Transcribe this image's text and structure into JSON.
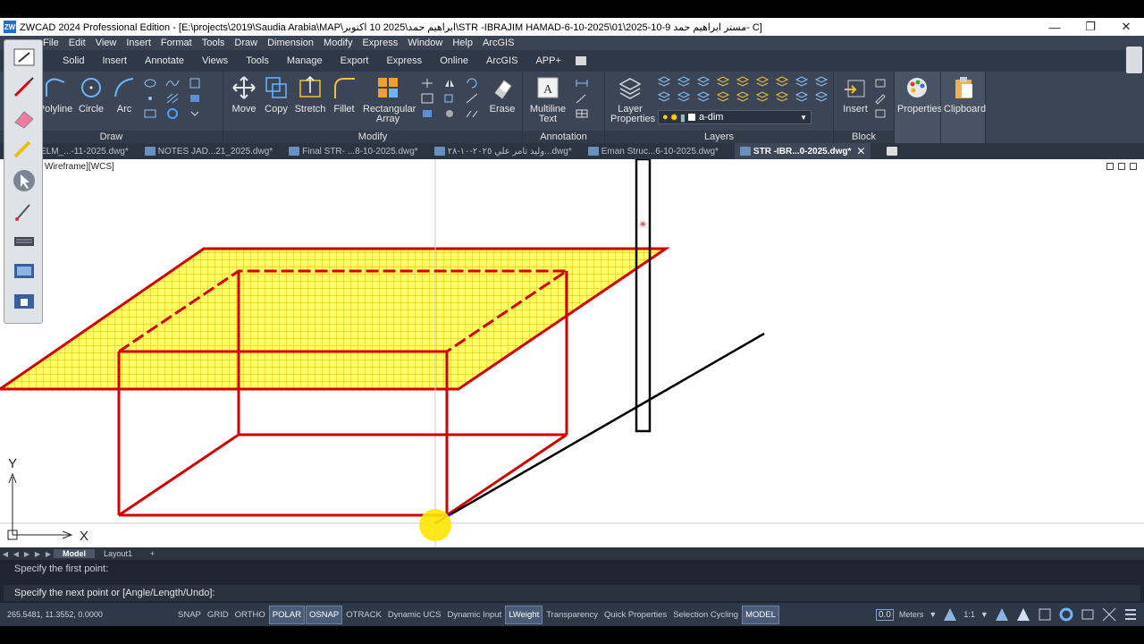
{
  "titlebar": {
    "app_icon_text": "ZW",
    "title": "ZWCAD 2024 Professional Edition - [E:\\projects\\2019\\Saudia Arabia\\MAP\\ابراهيم حمد\\2025 10 اكتوبر\\STR -IBRAJIM HAMAD-6-10-2025\\01\\2025-10-9 مستر ابراهيم حمد- C]",
    "minimize": "—",
    "restore": "❐",
    "close": "✕"
  },
  "menu": [
    "File",
    "Edit",
    "View",
    "Insert",
    "Format",
    "Tools",
    "Draw",
    "Dimension",
    "Modify",
    "Express",
    "Window",
    "Help",
    "ArcGIS"
  ],
  "ribbon_tabs": [
    "Solid",
    "Insert",
    "Annotate",
    "Views",
    "Tools",
    "Manage",
    "Export",
    "Express",
    "Online",
    "ArcGIS",
    "APP+"
  ],
  "ribbon": {
    "draw": {
      "label": "Draw",
      "polyline": "Polyline",
      "circle": "Circle",
      "arc": "Arc"
    },
    "modify": {
      "label": "Modify",
      "move": "Move",
      "copy": "Copy",
      "stretch": "Stretch",
      "fillet": "Fillet",
      "rect_array_1": "Rectangular",
      "rect_array_2": "Array",
      "erase": "Erase"
    },
    "annotation": {
      "label": "Annotation",
      "mtext_1": "Multiline",
      "mtext_2": "Text"
    },
    "layers": {
      "label": "Layers",
      "layer_props_1": "Layer",
      "layer_props_2": "Properties",
      "current_layer": "a-dim"
    },
    "block": {
      "label": "Block",
      "insert": "Insert"
    },
    "properties": {
      "label": "Properties"
    },
    "clipboard": {
      "label": "Clipboard"
    }
  },
  "doc_tabs": [
    {
      "label": "ELM_...-11-2025.dwg*"
    },
    {
      "label": "NOTES JAD...21_2025.dwg*"
    },
    {
      "label": "Final STR- ...8-10-2025.dwg*"
    },
    {
      "label": "وليد تامر علي ٢٠٢٥-١٠-٢٨...dwg*"
    },
    {
      "label": "Eman Struc...6-10-2025.dwg*"
    },
    {
      "label": "STR -IBR...0-2025.dwg*",
      "active": true,
      "close": "✕"
    }
  ],
  "viewport": {
    "label": "Wireframe][WCS]",
    "ucs_x": "X",
    "ucs_y": "Y"
  },
  "layout_tabs": {
    "model": "Model",
    "layout1": "Layout1",
    "add": "+"
  },
  "command": {
    "line1": "Specify the first point:",
    "line2": "Specify the next point or [Angle/Length/Undo]:"
  },
  "status": {
    "coords": "265.5481, 11.3552, 0.0000",
    "buttons": [
      {
        "label": "SNAP",
        "on": false
      },
      {
        "label": "GRID",
        "on": false
      },
      {
        "label": "ORTHO",
        "on": false
      },
      {
        "label": "POLAR",
        "on": true
      },
      {
        "label": "OSNAP",
        "on": true
      },
      {
        "label": "OTRACK",
        "on": false
      },
      {
        "label": "Dynamic UCS",
        "on": false
      },
      {
        "label": "Dynamic Input",
        "on": false
      },
      {
        "label": "LWeight",
        "on": true
      },
      {
        "label": "Transparency",
        "on": false
      },
      {
        "label": "Quick Properties",
        "on": false
      },
      {
        "label": "Selection Cycling",
        "on": false
      },
      {
        "label": "MODEL",
        "on": true
      }
    ],
    "scale_value": "0.0",
    "units": "Meters",
    "anno_scale": "1:1"
  },
  "colors": {
    "slab_fill": "#ffff66",
    "slab_grid": "#e6b800",
    "outline_red": "#d10000",
    "line_black": "#000000",
    "cursor_yellow": "#ffe600"
  }
}
